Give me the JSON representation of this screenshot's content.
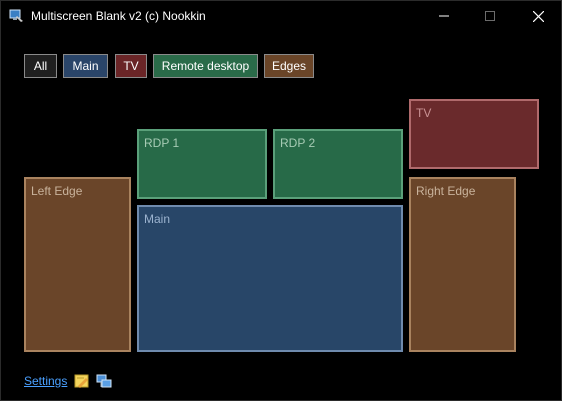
{
  "window": {
    "title": "Multiscreen Blank v2 (c) Nookkin"
  },
  "filters": {
    "all": "All",
    "main": "Main",
    "tv": "TV",
    "remote_desktop": "Remote desktop",
    "edges": "Edges"
  },
  "screens": {
    "rdp1": "RDP 1",
    "rdp2": "RDP 2",
    "tv": "TV",
    "left_edge": "Left Edge",
    "main": "Main",
    "right_edge": "Right Edge"
  },
  "footer": {
    "settings": "Settings"
  },
  "colors": {
    "main": "#284668",
    "tv": "#6a2a2c",
    "remote_desktop": "#276a48",
    "edges": "#6a4529",
    "link": "#4aa0ff"
  },
  "icons": [
    "app-icon",
    "minimize-icon",
    "maximize-icon",
    "close-icon",
    "note-icon",
    "network-icon"
  ]
}
